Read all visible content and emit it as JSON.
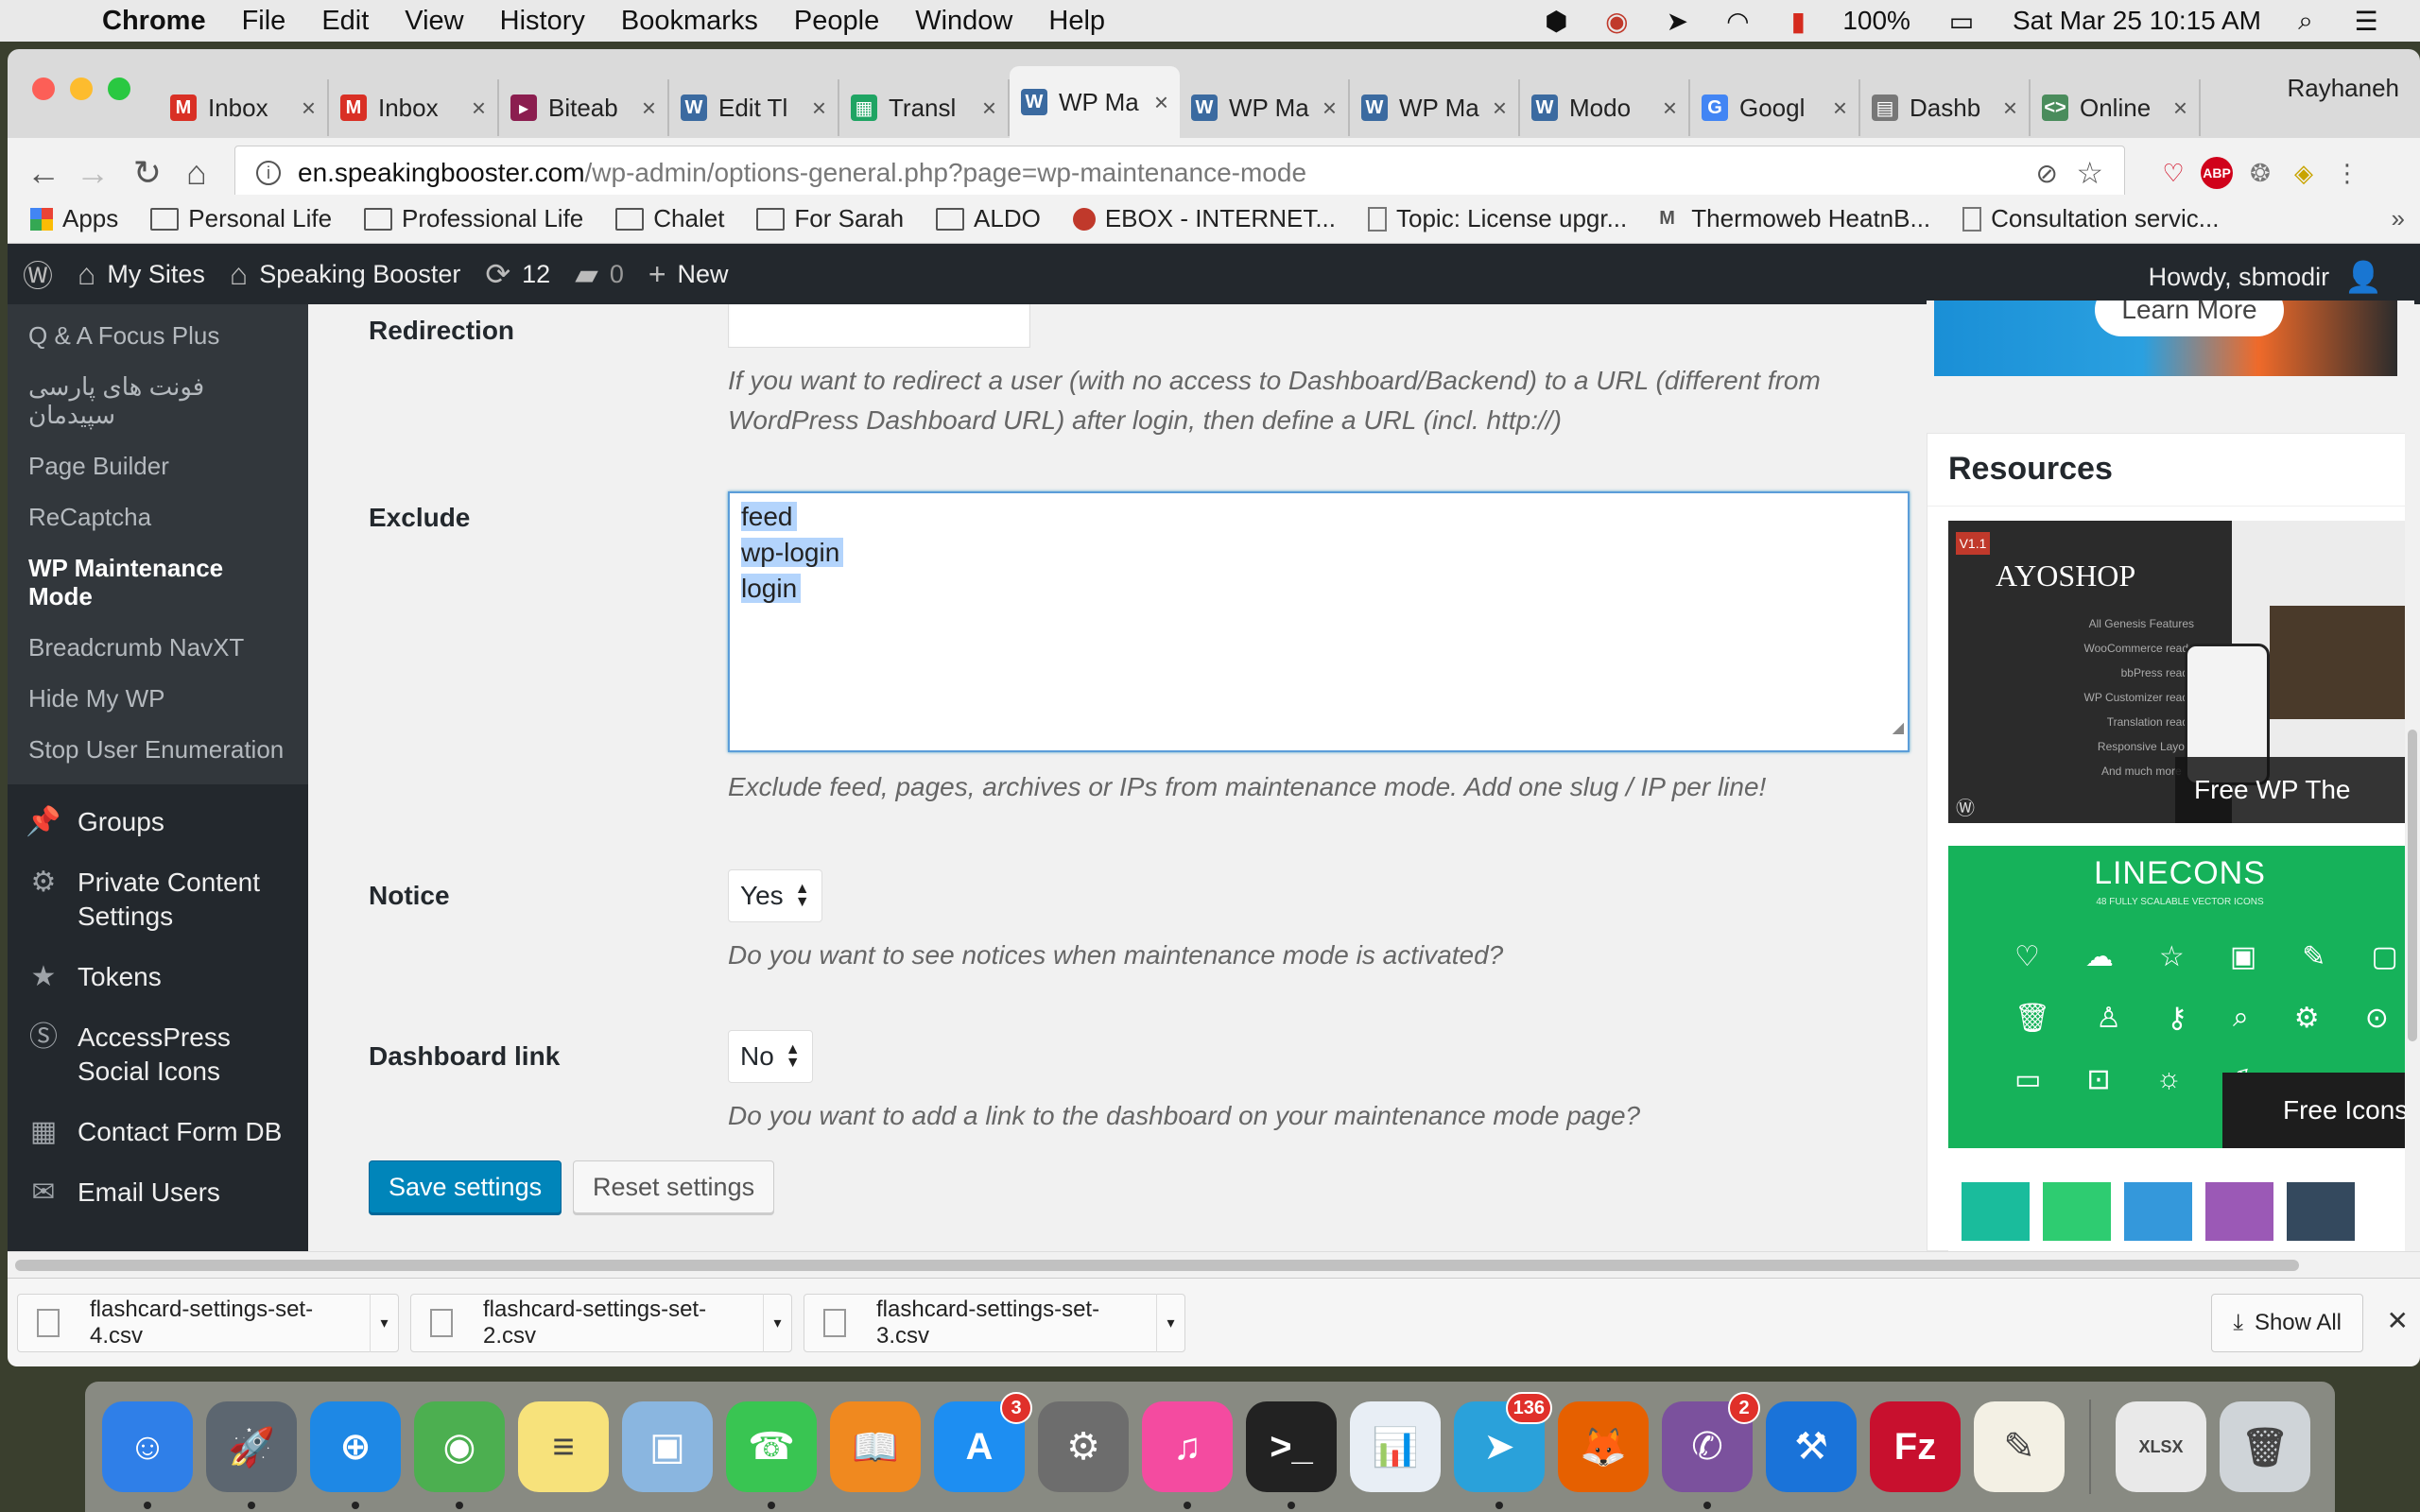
{
  "menubar": {
    "app": "Chrome",
    "items": [
      "File",
      "Edit",
      "View",
      "History",
      "Bookmarks",
      "People",
      "Window",
      "Help"
    ],
    "battery": "100%",
    "clock": "Sat Mar 25  10:15 AM"
  },
  "tabs": [
    {
      "label": "Inbox",
      "icon": "gmail-icon",
      "color": "#d93025",
      "glyph": "M"
    },
    {
      "label": "Inbox",
      "icon": "gmail-icon",
      "color": "#d93025",
      "glyph": "M"
    },
    {
      "label": "Biteab",
      "icon": "biteable-icon",
      "color": "#8b1e4f",
      "glyph": "▸"
    },
    {
      "label": "Edit Tl",
      "icon": "wordpress-icon",
      "color": "#3b6aa0",
      "glyph": "W"
    },
    {
      "label": "Transl",
      "icon": "sheets-icon",
      "color": "#1fa463",
      "glyph": "▦"
    },
    {
      "label": "WP Ma",
      "icon": "wordpress-icon",
      "color": "#3b6aa0",
      "glyph": "W",
      "active": true
    },
    {
      "label": "WP Ma",
      "icon": "wordpress-icon",
      "color": "#3b6aa0",
      "glyph": "W"
    },
    {
      "label": "WP Ma",
      "icon": "wordpress-icon",
      "color": "#3b6aa0",
      "glyph": "W"
    },
    {
      "label": "Modo",
      "icon": "wordpress-icon",
      "color": "#3b6aa0",
      "glyph": "W"
    },
    {
      "label": "Googl",
      "icon": "google-translate-icon",
      "color": "#4285f4",
      "glyph": "G"
    },
    {
      "label": "Dashb",
      "icon": "dashboard-icon",
      "color": "#777",
      "glyph": "▤"
    },
    {
      "label": "Online",
      "icon": "code-icon",
      "color": "#4a8c5c",
      "glyph": "<>"
    }
  ],
  "profile_name": "Rayhaneh",
  "omnibox": {
    "host": "en.speakingbooster.com",
    "path": "/wp-admin/options-general.php?page=wp-maintenance-mode"
  },
  "bookmarks": [
    {
      "label": "Apps",
      "type": "apps"
    },
    {
      "label": "Personal Life",
      "type": "folder"
    },
    {
      "label": "Professional Life",
      "type": "folder"
    },
    {
      "label": "Chalet",
      "type": "folder"
    },
    {
      "label": "For Sarah",
      "type": "folder"
    },
    {
      "label": "ALDO",
      "type": "folder"
    },
    {
      "label": "EBOX - INTERNET...",
      "type": "ebox"
    },
    {
      "label": "Topic: License upgr...",
      "type": "page"
    },
    {
      "label": "Thermoweb HeatnB...",
      "type": "thermo"
    },
    {
      "label": "Consultation servic...",
      "type": "page"
    }
  ],
  "wpbar": {
    "my_sites": "My Sites",
    "site": "Speaking Booster",
    "updates": "12",
    "comments": "0",
    "new": "New",
    "howdy": "Howdy, sbmodir"
  },
  "sidebar": {
    "submenu": [
      {
        "label": "Q & A Focus Plus"
      },
      {
        "label": "فونت های پارسی سپیدمان"
      },
      {
        "label": "Page Builder"
      },
      {
        "label": "ReCaptcha"
      },
      {
        "label": "WP Maintenance Mode",
        "current": true
      },
      {
        "label": "Breadcrumb NavXT"
      },
      {
        "label": "Hide My WP"
      },
      {
        "label": "Stop User Enumeration"
      }
    ],
    "menu": [
      {
        "label": "Groups",
        "icon": "pin-icon"
      },
      {
        "label": "Private Content Settings",
        "icon": "gear-icon"
      },
      {
        "label": "Tokens",
        "icon": "star-icon"
      },
      {
        "label": "AccessPress Social Icons",
        "icon": "si-icon"
      },
      {
        "label": "Contact Form DB",
        "icon": "db-icon"
      },
      {
        "label": "Email Users",
        "icon": "mail-icon"
      }
    ]
  },
  "form": {
    "redirection": {
      "label": "Redirection",
      "value": "",
      "desc": "If you want to redirect a user (with no access to Dashboard/Backend) to a URL (different from WordPress Dashboard URL) after login, then define a URL (incl. http://)"
    },
    "exclude": {
      "label": "Exclude",
      "lines": [
        "feed",
        "wp-login",
        "login"
      ],
      "desc": "Exclude feed, pages, archives or IPs from maintenance mode. Add one slug / IP per line!"
    },
    "notice": {
      "label": "Notice",
      "value": "Yes",
      "desc": "Do you want to see notices when maintenance mode is activated?"
    },
    "dashboard_link": {
      "label": "Dashboard link",
      "value": "No",
      "desc": "Do you want to add a link to the dashboard on your maintenance mode page?"
    },
    "save": "Save settings",
    "reset": "Reset settings"
  },
  "rightcol": {
    "learn_more": "Learn More",
    "resources_title": "Resources",
    "ad1": {
      "brand": "AYOSHOP",
      "version": "V1.1",
      "features": [
        "All Genesis Features",
        "WooCommerce ready",
        "bbPress ready",
        "WP Customizer ready",
        "Translation ready",
        "Responsive Layout",
        "And much more ..."
      ],
      "caption": "Free WP The"
    },
    "ad2": {
      "title": "LINECONS",
      "subtitle": "48 FULLY SCALABLE VECTOR ICONS",
      "caption": "Free Icons"
    },
    "ad3_swatches": [
      "#1abc9c",
      "#2ecc71",
      "#3498db",
      "#9b59b6",
      "#34495e"
    ]
  },
  "downloads": [
    {
      "name": "flashcard-settings-set-4.csv"
    },
    {
      "name": "flashcard-settings-set-2.csv"
    },
    {
      "name": "flashcard-settings-set-3.csv"
    }
  ],
  "show_all": "Show All",
  "dock": [
    {
      "name": "finder",
      "bg": "#2f7fe8",
      "glyph": "☺"
    },
    {
      "name": "launchpad",
      "bg": "#5c6670",
      "glyph": "🚀"
    },
    {
      "name": "safari",
      "bg": "#1e88e5",
      "glyph": "⊕"
    },
    {
      "name": "chrome",
      "bg": "#4caf50",
      "glyph": "◉"
    },
    {
      "name": "notes",
      "bg": "#f7e27b",
      "glyph": "≡"
    },
    {
      "name": "preview",
      "bg": "#8ab6e0",
      "glyph": "▣"
    },
    {
      "name": "facetime",
      "bg": "#39c552",
      "glyph": "☎"
    },
    {
      "name": "ibooks",
      "bg": "#f0891f",
      "glyph": "📖"
    },
    {
      "name": "app-store",
      "bg": "#1d8ef2",
      "glyph": "A",
      "badge": "3"
    },
    {
      "name": "system-preferences",
      "bg": "#6d6d6d",
      "glyph": "⚙"
    },
    {
      "name": "itunes",
      "bg": "#f44ba0",
      "glyph": "♫"
    },
    {
      "name": "terminal",
      "bg": "#222",
      "glyph": ">_"
    },
    {
      "name": "numbers",
      "bg": "#e8eef5",
      "glyph": "📊"
    },
    {
      "name": "telegram",
      "bg": "#2aa1da",
      "glyph": "➤",
      "badge": "136"
    },
    {
      "name": "firefox",
      "bg": "#e66000",
      "glyph": "🦊"
    },
    {
      "name": "viber",
      "bg": "#7b519d",
      "glyph": "✆",
      "badge": "2"
    },
    {
      "name": "xcode",
      "bg": "#1a73d9",
      "glyph": "⚒"
    },
    {
      "name": "filezilla",
      "bg": "#c8102e",
      "glyph": "Fz"
    },
    {
      "name": "script-editor",
      "bg": "#f3f0e4",
      "glyph": "✎"
    },
    {
      "name": "document",
      "bg": "#e9e9e9",
      "glyph": "XLSX"
    },
    {
      "name": "trash",
      "bg": "#cfd4d8",
      "glyph": "🗑"
    }
  ]
}
